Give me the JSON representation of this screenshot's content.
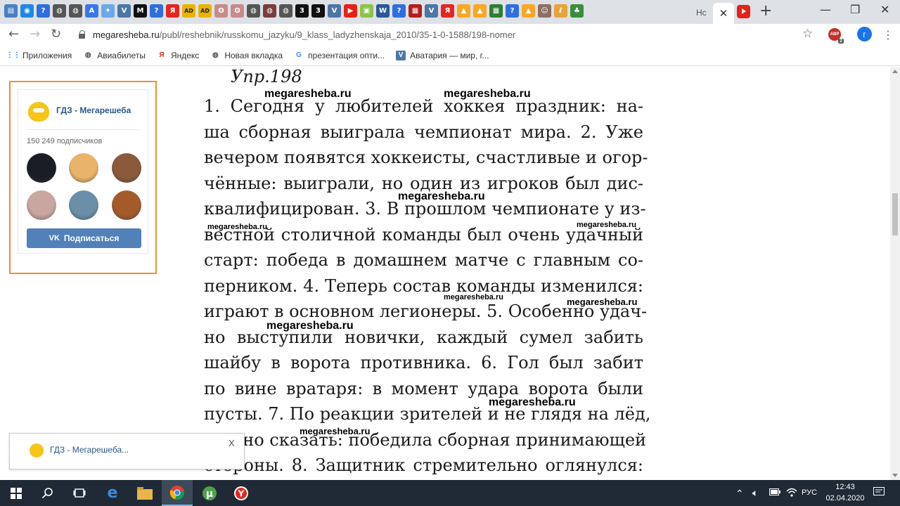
{
  "browser": {
    "active_tab_title": "Нс",
    "close_tab_glyph": "✕",
    "new_tab_glyph": "+",
    "window_controls": [
      "—",
      "❐",
      "✕"
    ],
    "url_host": "megaresheba.ru",
    "url_path": "/publ/reshebnik/russkomu_jazyku/9_klass_ladyzhenskaja_2010/35-1-0-1588/198-nomer",
    "abp_badge": "2",
    "profile_initial": "г",
    "tab_favicons": [
      {
        "icon": "page-icon",
        "color": "#4a7fc1",
        "glyph": "▤"
      },
      {
        "icon": "circle-icon",
        "color": "#1e88e5",
        "glyph": "◉"
      },
      {
        "icon": "help-icon",
        "color": "#2f6fdd",
        "glyph": "?"
      },
      {
        "icon": "globe-icon",
        "color": "#555555",
        "glyph": "◍"
      },
      {
        "icon": "globe-icon",
        "color": "#555555",
        "glyph": "◍"
      },
      {
        "icon": "translate-icon",
        "color": "#3b78e7",
        "glyph": "A"
      },
      {
        "icon": "bulb-icon",
        "color": "#6aa9e9",
        "glyph": "✦"
      },
      {
        "icon": "vk-icon",
        "color": "#4a76a8",
        "glyph": "V"
      },
      {
        "icon": "m-icon",
        "color": "#111111",
        "glyph": "M"
      },
      {
        "icon": "help-icon",
        "color": "#2f6fdd",
        "glyph": "?"
      },
      {
        "icon": "yandex-icon",
        "color": "#e52620",
        "glyph": "Я"
      },
      {
        "icon": "ad-icon",
        "color": "#e8b400",
        "glyph": "AD"
      },
      {
        "icon": "ad-icon",
        "color": "#e8b400",
        "glyph": "AD"
      },
      {
        "icon": "owl-icon",
        "color": "#c98a8a",
        "glyph": "ʘ"
      },
      {
        "icon": "owl-icon",
        "color": "#c98a8a",
        "glyph": "ʘ"
      },
      {
        "icon": "globe-icon",
        "color": "#555555",
        "glyph": "◍"
      },
      {
        "icon": "globe-icon",
        "color": "#7a3b3b",
        "glyph": "◍"
      },
      {
        "icon": "globe-icon",
        "color": "#555555",
        "glyph": "◍"
      },
      {
        "icon": "three-icon",
        "color": "#111111",
        "glyph": "3"
      },
      {
        "icon": "three-icon",
        "color": "#111111",
        "glyph": "3"
      },
      {
        "icon": "vk-icon",
        "color": "#4a76a8",
        "glyph": "V"
      },
      {
        "icon": "youtube-icon",
        "color": "#e62117",
        "glyph": "▶"
      },
      {
        "icon": "image-icon",
        "color": "#8bc34a",
        "glyph": "▣"
      },
      {
        "icon": "word-icon",
        "color": "#2b5797",
        "glyph": "W"
      },
      {
        "icon": "help-icon",
        "color": "#2f6fdd",
        "glyph": "?"
      },
      {
        "icon": "grid-icon",
        "color": "#b71c1c",
        "glyph": "▦"
      },
      {
        "icon": "vk-icon",
        "color": "#4a76a8",
        "glyph": "V"
      },
      {
        "icon": "yandex-icon",
        "color": "#e52620",
        "glyph": "Я"
      },
      {
        "icon": "mountain-icon",
        "color": "#f9a825",
        "glyph": "▲"
      },
      {
        "icon": "mountain-icon",
        "color": "#f9a825",
        "glyph": "▲"
      },
      {
        "icon": "table-icon",
        "color": "#2e7d32",
        "glyph": "▦"
      },
      {
        "icon": "help-icon",
        "color": "#2f6fdd",
        "glyph": "?"
      },
      {
        "icon": "mountain-icon",
        "color": "#f9a825",
        "glyph": "▲"
      },
      {
        "icon": "person-icon",
        "color": "#8d6e63",
        "glyph": "☺"
      },
      {
        "icon": "pdf-icon",
        "color": "#e8a33a",
        "glyph": "ℓ"
      },
      {
        "icon": "leaf-icon",
        "color": "#388e3c",
        "glyph": "♣"
      }
    ]
  },
  "bookmarks": [
    {
      "label": "Приложения",
      "icon": "apps-icon",
      "color": "#1a73e8",
      "glyph": "⋮⋮"
    },
    {
      "label": "Авиабилеты",
      "icon": "globe-icon",
      "color": "#555555",
      "glyph": "◍"
    },
    {
      "label": "Яндекс",
      "icon": "yandex-icon",
      "color": "#e52620",
      "glyph": "Я"
    },
    {
      "label": "Новая вкладка",
      "icon": "globe-icon",
      "color": "#555555",
      "glyph": "◍"
    },
    {
      "label": "презентация опти...",
      "icon": "google-icon",
      "color": "#4285f4",
      "glyph": "G"
    },
    {
      "label": "Аватария — мир, г...",
      "icon": "vk-icon",
      "color": "#4a76a8",
      "glyph": "V"
    }
  ],
  "vk_widget": {
    "title": "ГДЗ - Мегарешеба",
    "subscribers": "150 249 подписчиков",
    "subscribe_label": "Подписаться",
    "avatar_colors": [
      "#1b1d26",
      "#e9b36a",
      "#8a5a3a",
      "#c9a6a0",
      "#6b8fa8",
      "#a35b2b"
    ]
  },
  "popup": {
    "text": "ГДЗ - Мегарешеба...",
    "close": "X"
  },
  "scan": {
    "heading": "Упр.198",
    "lines": [
      "1. Сегодня у любителей хоккея праздник: на-",
      "ша сборная выиграла чемпионат мира. 2. Уже",
      "вечером появятся хоккеисты, счастливые и огор-",
      "чённые: выиграли, но один из игроков был дис-",
      "квалифицирован. 3. В прошлом чемпионате у из-",
      "вестной столичной команды был очень удачный",
      "старт: победа в домашнем матче с главным со-",
      "перником. 4. Теперь состав команды изменился:",
      "играют в основном легионеры. 5. Особенно удач-",
      "но выступили новички, каждый сумел забить",
      "шайбу в ворота противника. 6. Гол был забит",
      "по вине вратаря: в момент удара ворота были",
      "пусты. 7. По реакции зрителей и не глядя на лёд,",
      "можно сказать: победила сборная принимающей",
      "стороны. 8. Защитник стремительно оглянулся:"
    ],
    "watermark": "megaresheba.ru"
  },
  "taskbar": {
    "language": "РУС",
    "time": "12:43",
    "date": "02.04.2020"
  }
}
